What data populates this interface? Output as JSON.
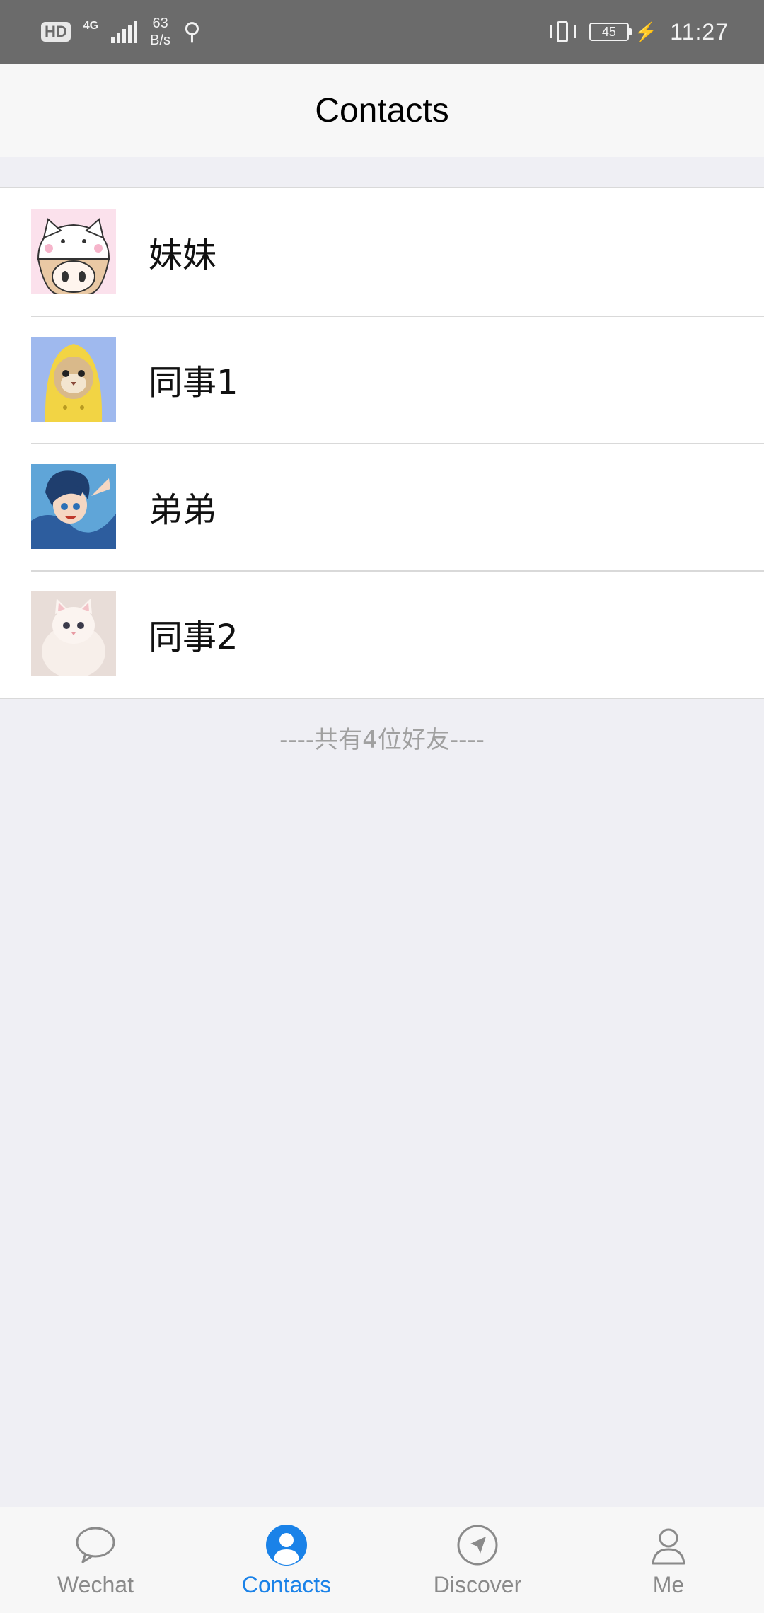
{
  "status_bar": {
    "hd": "HD",
    "network_type": "4G",
    "speed_value": "63",
    "speed_unit": "B/s",
    "battery_level": "45",
    "time": "11:27"
  },
  "header": {
    "title": "Contacts"
  },
  "contacts": [
    {
      "name": "妹妹"
    },
    {
      "name": "同事1"
    },
    {
      "name": "弟弟"
    },
    {
      "name": "同事2"
    }
  ],
  "friend_count_text": "----共有4位好友----",
  "tabs": [
    {
      "label": "Wechat",
      "icon": "chat-bubble-icon",
      "active": false
    },
    {
      "label": "Contacts",
      "icon": "person-icon",
      "active": true
    },
    {
      "label": "Discover",
      "icon": "compass-icon",
      "active": false
    },
    {
      "label": "Me",
      "icon": "user-outline-icon",
      "active": false
    }
  ],
  "colors": {
    "accent": "#1a82e8",
    "inactive_tab": "#8a8a8a",
    "background": "#efeff4",
    "status_bar": "#6b6b6b"
  }
}
